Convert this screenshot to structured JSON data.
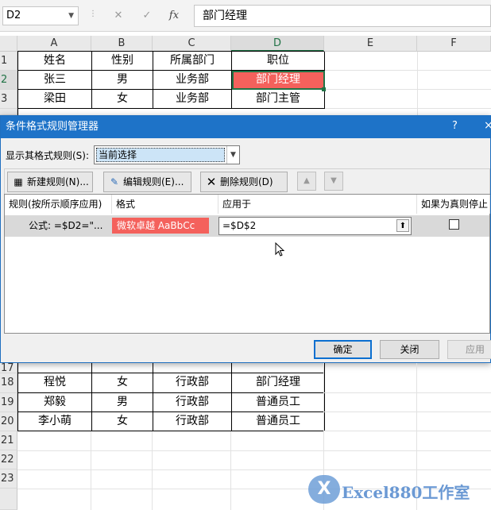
{
  "formula_bar": {
    "name_box": "D2",
    "cancel_glyph": "✕",
    "enter_glyph": "✓",
    "fx_label": "fx",
    "formula": "部门经理"
  },
  "columns": [
    "A",
    "B",
    "C",
    "D",
    "E",
    "F"
  ],
  "rows": [
    "1",
    "2",
    "3",
    "17",
    "18",
    "19",
    "20",
    "21",
    "22",
    "23"
  ],
  "table_top": [
    [
      "姓名",
      "性别",
      "所属部门",
      "职位"
    ],
    [
      "张三",
      "男",
      "业务部",
      "部门经理"
    ],
    [
      "梁田",
      "女",
      "业务部",
      "部门主管"
    ]
  ],
  "table_bottom": [
    [
      "程悦",
      "女",
      "行政部",
      "部门经理"
    ],
    [
      "郑毅",
      "男",
      "行政部",
      "普通员工"
    ],
    [
      "李小萌",
      "女",
      "行政部",
      "普通员工"
    ]
  ],
  "dialog": {
    "title": "条件格式规则管理器",
    "help": "?",
    "close": "×",
    "show_label": "显示其格式规则(S):",
    "show_value": "当前选择",
    "new_rule": "新建规则(N)...",
    "edit_rule": "编辑规则(E)...",
    "delete_rule": "删除规则(D)",
    "col_rule": "规则(按所示顺序应用)",
    "col_format": "格式",
    "col_applies": "应用于",
    "col_stop": "如果为真则停止",
    "rule_text": "公式: =$D2=\"...",
    "format_preview": "微软卓越  AaBbCc",
    "applies_to": "=$D$2",
    "ok": "确定",
    "close_btn": "关闭",
    "apply": "应用"
  },
  "watermark": {
    "logo": "X",
    "text": "Excel880工作室"
  },
  "colors": {
    "accent": "#217346",
    "highlight": "#f4615c",
    "dialog_title": "#1e73c8"
  }
}
